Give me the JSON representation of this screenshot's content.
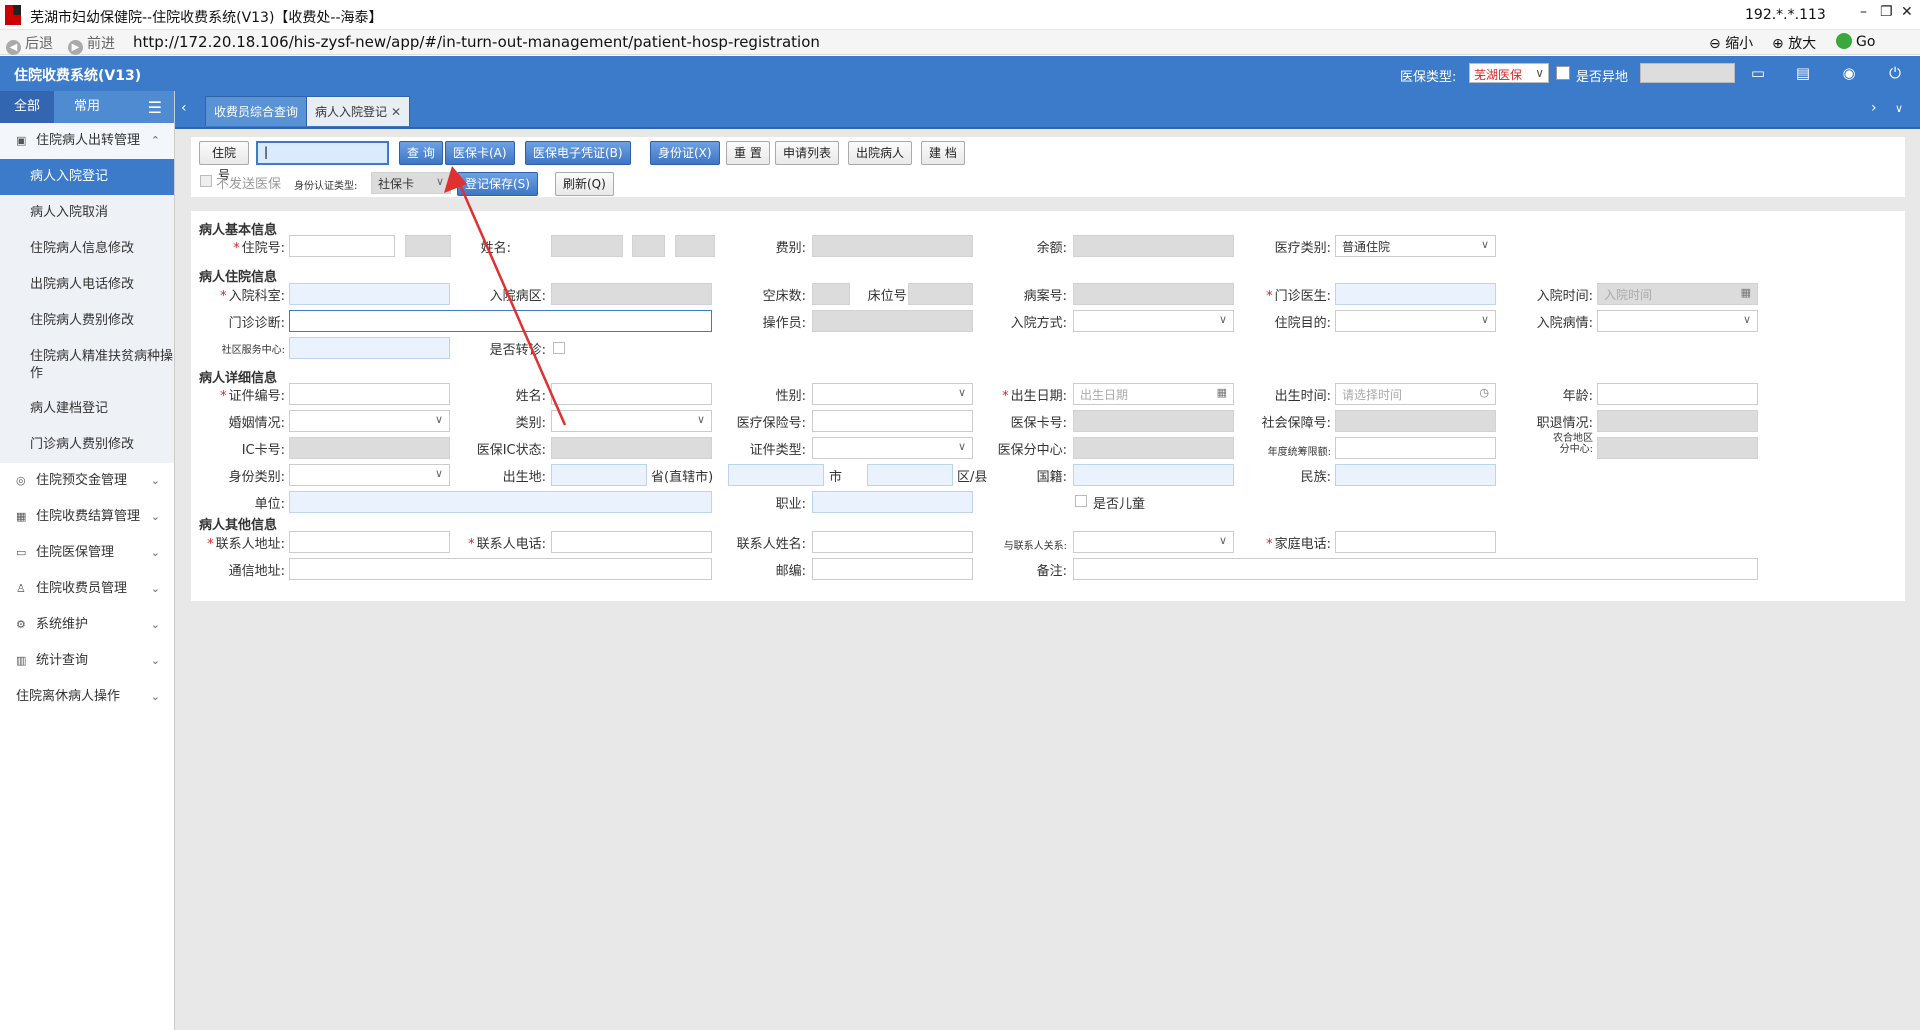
{
  "window": {
    "title": "芜湖市妇幼保健院--住院收费系统(V13)【收费处--海泰】",
    "ip": "192.*.*.113",
    "min": "–",
    "restore": "❐",
    "close": "✕"
  },
  "addressbar": {
    "back": "后退",
    "forward": "前进",
    "url": "http://172.20.18.106/his-zysf-new/app/#/in-turn-out-management/patient-hosp-registration",
    "zoom_out": "缩小",
    "zoom_in": "放大",
    "go": "Go"
  },
  "header": {
    "title": "住院收费系统(V13)",
    "insurance_label": "医保类型:",
    "insurance_value": "芜湖医保",
    "remote_label": "是否异地"
  },
  "sidebar": {
    "tab_all": "全部",
    "tab_common": "常用",
    "groups": [
      {
        "label": "住院病人出转管理",
        "items": [
          "病人入院登记",
          "病人入院取消",
          "住院病人信息修改",
          "出院病人电话修改",
          "住院病人费别修改",
          "住院病人精准扶贫病种操作",
          "病人建档登记",
          "门诊病人费别修改"
        ]
      },
      {
        "label": "住院预交金管理"
      },
      {
        "label": "住院收费结算管理"
      },
      {
        "label": "住院医保管理"
      },
      {
        "label": "住院收费员管理"
      },
      {
        "label": "系统维护"
      },
      {
        "label": "统计查询"
      },
      {
        "label": "住院离休病人操作"
      }
    ]
  },
  "tabs": [
    {
      "label": "收费员综合查询"
    },
    {
      "label": "病人入院登记"
    }
  ],
  "toolbar": {
    "hosp_no_label": "住院号",
    "query": "查 询",
    "ins_card": "医保卡(A)",
    "ins_ecert": "医保电子凭证(B)",
    "id_card": "身份证(X)",
    "reset": "重 置",
    "apply_list": "申请列表",
    "discharged": "出院病人",
    "create_file": "建 档",
    "no_send_ins": "不发送医保",
    "id_auth_label": "身份认证类型:",
    "id_auth_value": "社保卡",
    "save_reg": "登记保存(S)",
    "refresh": "刷新(Q)"
  },
  "form": {
    "sec_basic": "病人基本信息",
    "hosp_no": "住院号:",
    "name": "姓名:",
    "fee_type": "费别:",
    "balance": "余额:",
    "med_type": "医疗类别:",
    "med_type_value": "普通住院",
    "sec_hosp": "病人住院信息",
    "dept": "入院科室:",
    "ward": "入院病区:",
    "empty_beds": "空床数:",
    "bed_no": "床位号:",
    "case_no": "病案号:",
    "outpatient_doctor": "门诊医生:",
    "admit_time": "入院时间:",
    "admit_time_ph": "入院时间",
    "diagnosis": "门诊诊断:",
    "operator": "操作员:",
    "admit_method": "入院方式:",
    "hosp_purpose": "住院目的:",
    "admit_condition": "入院病情:",
    "community": "社区服务中心:",
    "transfer": "是否转诊:",
    "sec_detail": "病人详细信息",
    "id_no": "证件编号:",
    "name2": "姓名:",
    "gender": "性别:",
    "birth_date": "出生日期:",
    "birth_date_ph": "出生日期",
    "birth_time": "出生时间:",
    "birth_time_ph": "请选择时间",
    "age": "年龄:",
    "marital": "婚姻情况:",
    "category": "类别:",
    "ins_no": "医疗保险号:",
    "ins_card_no": "医保卡号:",
    "ss_no": "社会保障号:",
    "retire": "职退情况:",
    "ic_card": "IC卡号:",
    "ic_status": "医保IC状态:",
    "id_type": "证件类型:",
    "ins_center": "医保分中心:",
    "annual_limit": "年度统筹限额:",
    "rural_area_top": "农合地区",
    "rural_area_bot": "分中心:",
    "id_category": "身份类别:",
    "birthplace": "出生地:",
    "province": "省(直辖市)",
    "city": "市",
    "district": "区/县",
    "nationality": "国籍:",
    "ethnicity": "民族:",
    "workplace": "单位:",
    "occupation": "职业:",
    "is_child": "是否儿童",
    "sec_other": "病人其他信息",
    "contact_addr": "联系人地址:",
    "contact_phone": "联系人电话:",
    "contact_name": "联系人姓名:",
    "contact_relation": "与联系人关系:",
    "home_phone": "家庭电话:",
    "mail_addr": "通信地址:",
    "postcode": "邮编:",
    "remark": "备注:"
  },
  "colors": {
    "header_blue": "#3b7bc9",
    "required_star": "#d22222",
    "annotation_arrow": "#e03030"
  }
}
